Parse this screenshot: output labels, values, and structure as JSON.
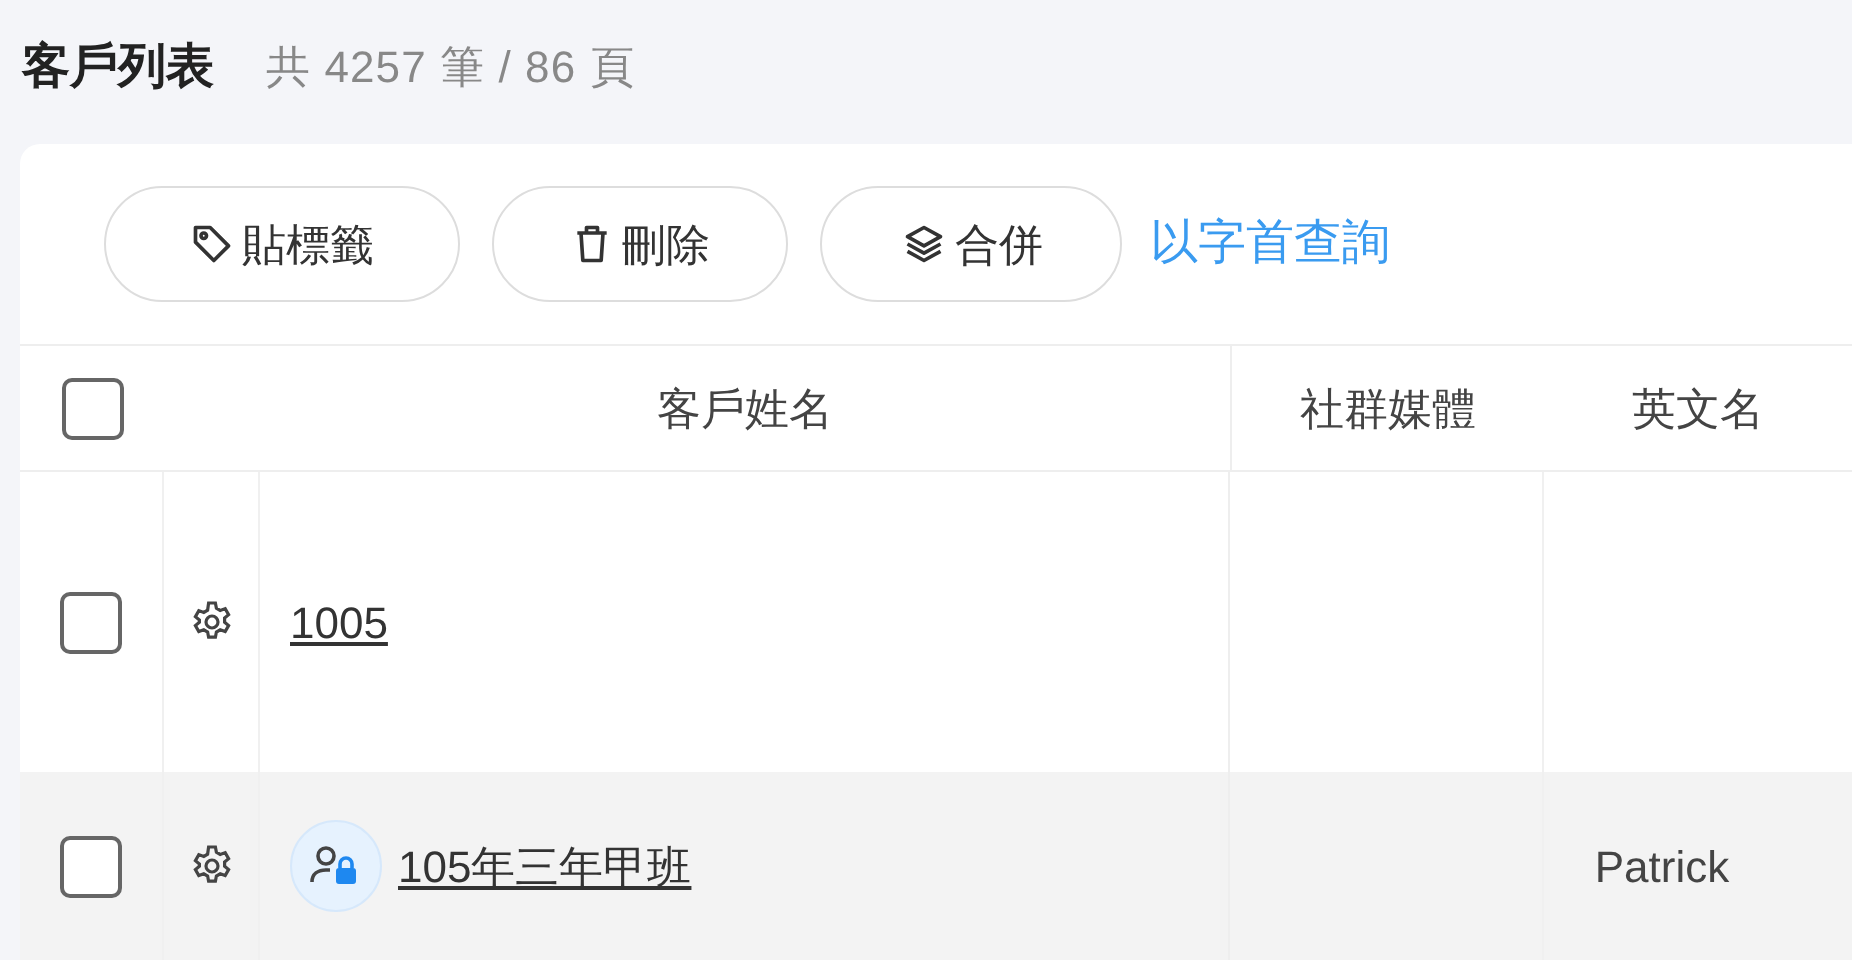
{
  "page": {
    "title": "客戶列表",
    "summary": "共 4257 筆 / 86 頁"
  },
  "toolbar": {
    "buttons": [
      {
        "kind": "tag",
        "label": "貼標籤"
      },
      {
        "kind": "delete",
        "label": "刪除"
      },
      {
        "kind": "merge",
        "label": "合併"
      }
    ],
    "link": "以字首查詢"
  },
  "table": {
    "select_all_checked": false,
    "columns": [
      "客戶姓名",
      "社群媒體",
      "英文名"
    ],
    "rows": [
      {
        "checked": false,
        "highlighted": false,
        "locked": false,
        "name": "1005",
        "english_name": ""
      },
      {
        "checked": false,
        "highlighted": true,
        "locked": true,
        "name": "105年三年甲班",
        "english_name": "Patrick"
      }
    ]
  }
}
